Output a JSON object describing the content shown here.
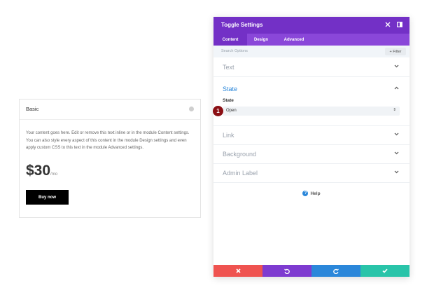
{
  "card": {
    "title": "Basic",
    "body": "Your content goes here. Edit or remove this text inline or in the module Content settings. You can also style every aspect of this content in the module Design settings and even apply custom CSS to this text in the module Advanced settings.",
    "price": "$30",
    "per": "/mo",
    "button": "Buy now"
  },
  "panel": {
    "title": "Toggle Settings",
    "tabs": [
      "Content",
      "Design",
      "Advanced"
    ],
    "search_placeholder": "Search Options",
    "filter": "+ Filter",
    "sections": {
      "text": "Text",
      "state": "State",
      "link": "Link",
      "background": "Background",
      "admin_label": "Admin Label"
    },
    "state_field_label": "State",
    "state_value": "Open",
    "badge": "1",
    "help": "Help"
  },
  "icons": {
    "close": "close-icon",
    "expand": "expand-icon",
    "chevron_down": "chevron-down-icon",
    "chevron_up": "chevron-up-icon",
    "help": "help-icon",
    "cancel": "x-icon",
    "undo": "undo-icon",
    "redo": "redo-icon",
    "save": "check-icon"
  },
  "colors": {
    "header": "#7330c6",
    "tabs": "#8a47d9",
    "accent": "#2b87da",
    "cancel": "#ef5350",
    "undo": "#7e3bd0",
    "redo": "#2b87da",
    "save": "#29c4a9",
    "badge": "#8b0f14"
  }
}
